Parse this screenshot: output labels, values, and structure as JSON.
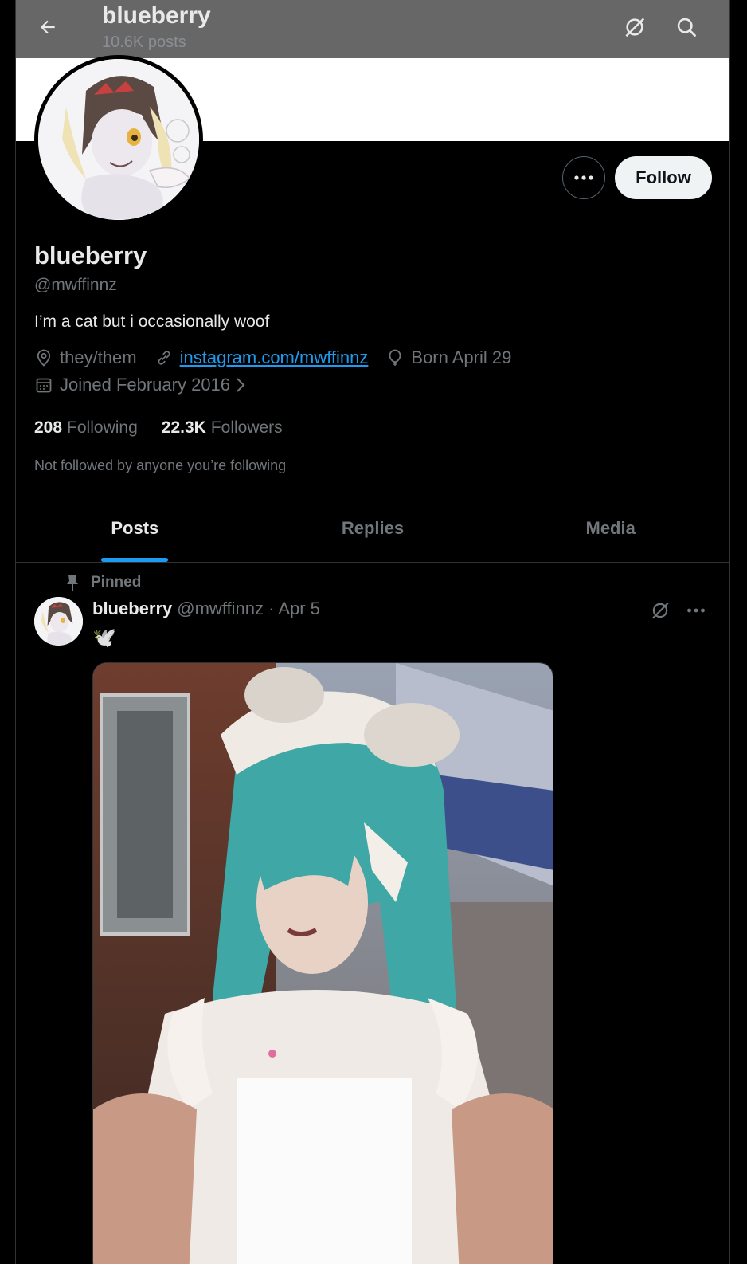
{
  "header": {
    "title": "blueberry",
    "post_count": "10.6K posts"
  },
  "profile": {
    "display_name": "blueberry",
    "handle": "@mwffinnz",
    "bio": "I’m a cat but i occasionally woof",
    "location": "they/them",
    "link": "instagram.com/mwffinnz",
    "birthday": "Born April 29",
    "joined": "Joined February 2016",
    "following_count": "208",
    "following_label": "Following",
    "followers_count": "22.3K",
    "followers_label": "Followers",
    "not_followed_text": "Not followed by anyone you’re following"
  },
  "actions": {
    "follow_label": "Follow"
  },
  "tabs": [
    {
      "label": "Posts",
      "active": true
    },
    {
      "label": "Replies",
      "active": false
    },
    {
      "label": "Media",
      "active": false
    }
  ],
  "pinned_post": {
    "pinned_label": "Pinned",
    "author_name": "blueberry",
    "author_handle_date": "@mwffinnz · Apr 5",
    "text": "🕊️"
  },
  "colors": {
    "accent": "#1d9bf0",
    "background": "#000000",
    "muted_text": "#71767b"
  },
  "icons": [
    "back-arrow-icon",
    "grok-icon",
    "search-icon",
    "more-icon",
    "location-icon",
    "link-icon",
    "balloon-icon",
    "calendar-icon",
    "chevron-right-icon",
    "pin-icon"
  ]
}
